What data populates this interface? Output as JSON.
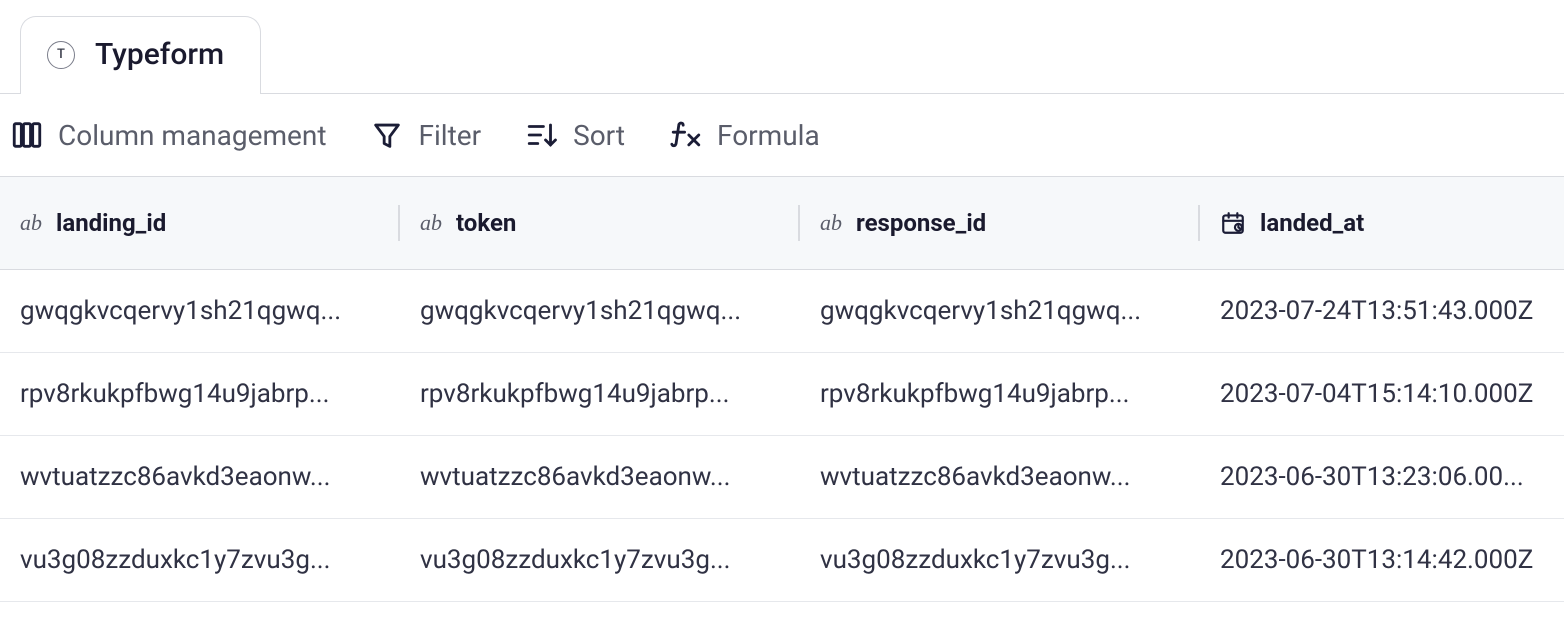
{
  "tab": {
    "icon_glyph": "T",
    "label": "Typeform"
  },
  "toolbar": {
    "column_management": "Column management",
    "filter": "Filter",
    "sort": "Sort",
    "formula": "Formula"
  },
  "columns": [
    {
      "type": "text",
      "name": "landing_id"
    },
    {
      "type": "text",
      "name": "token"
    },
    {
      "type": "text",
      "name": "response_id"
    },
    {
      "type": "date",
      "name": "landed_at"
    }
  ],
  "rows": [
    {
      "landing_id": "gwqgkvcqervy1sh21qgwq...",
      "token": "gwqgkvcqervy1sh21qgwq...",
      "response_id": "gwqgkvcqervy1sh21qgwq...",
      "landed_at": "2023-07-24T13:51:43.000Z"
    },
    {
      "landing_id": "rpv8rkukpfbwg14u9jabrp...",
      "token": "rpv8rkukpfbwg14u9jabrp...",
      "response_id": "rpv8rkukpfbwg14u9jabrp...",
      "landed_at": "2023-07-04T15:14:10.000Z"
    },
    {
      "landing_id": "wvtuatzzc86avkd3eaonw...",
      "token": "wvtuatzzc86avkd3eaonw...",
      "response_id": "wvtuatzzc86avkd3eaonw...",
      "landed_at": "2023-06-30T13:23:06.00..."
    },
    {
      "landing_id": "vu3g08zzduxkc1y7zvu3g...",
      "token": "vu3g08zzduxkc1y7zvu3g...",
      "response_id": "vu3g08zzduxkc1y7zvu3g...",
      "landed_at": "2023-06-30T13:14:42.000Z"
    }
  ]
}
